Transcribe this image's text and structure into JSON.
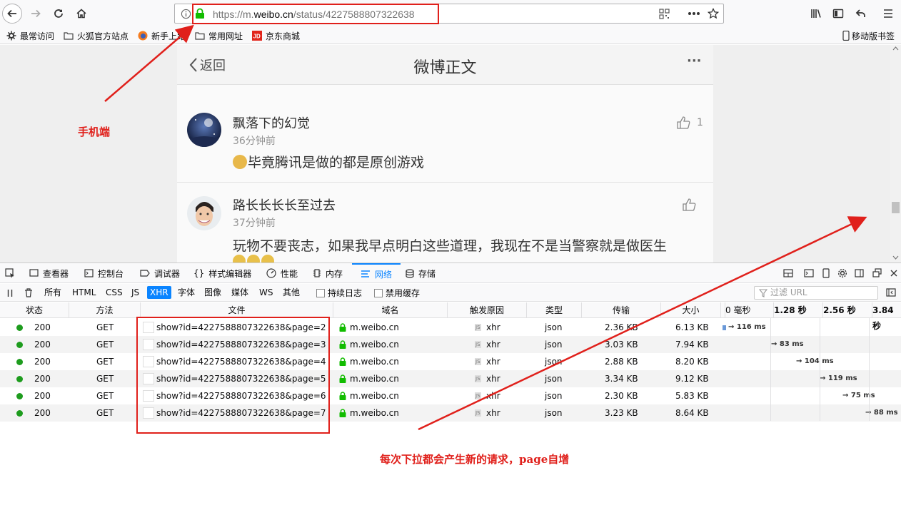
{
  "browser": {
    "url_prefix": "https://m.",
    "url_host": "weibo.cn",
    "url_path": "/status/4227588807322638",
    "bookmarks": [
      "最常访问",
      "火狐官方站点",
      "新手上路",
      "常用网址",
      "京东商城"
    ],
    "mobile_bookmarks": "移动版书签"
  },
  "mobile": {
    "back_label": "返回",
    "title": "微博正文",
    "more": "···",
    "comments": [
      {
        "name": "飘落下的幻觉",
        "time": "36分钟前",
        "text": "毕竟腾讯是做的都是原创游戏",
        "likes": "1"
      },
      {
        "name": "路长长长长至过去",
        "time": "37分钟前",
        "text": "玩物不要丧志，如果我早点明白这些道理，我现在不是当警察就是做医生",
        "likes": ""
      }
    ]
  },
  "devtools": {
    "tabs": [
      "查看器",
      "控制台",
      "调试器",
      "样式编辑器",
      "性能",
      "内存",
      "网络",
      "存储"
    ],
    "active_tab": "网络",
    "filters": [
      "所有",
      "HTML",
      "CSS",
      "JS",
      "XHR",
      "字体",
      "图像",
      "媒体",
      "WS",
      "其他"
    ],
    "active_filter": "XHR",
    "persist_logs": "持续日志",
    "disable_cache": "禁用缓存",
    "filter_url_placeholder": "过滤 URL",
    "columns": [
      "状态",
      "方法",
      "文件",
      "域名",
      "触发原因",
      "类型",
      "传输",
      "大小"
    ],
    "timeline_ticks": [
      "0 毫秒",
      "1.28 秒",
      "2.56 秒",
      "3.84 秒"
    ],
    "requests": [
      {
        "status": "200",
        "method": "GET",
        "file": "show?id=4227588807322638&page=2",
        "domain": "m.weibo.cn",
        "cause": "xhr",
        "type": "json",
        "transferred": "2.36 KB",
        "size": "6.13 KB",
        "timing": "→ 116 ms"
      },
      {
        "status": "200",
        "method": "GET",
        "file": "show?id=4227588807322638&page=3",
        "domain": "m.weibo.cn",
        "cause": "xhr",
        "type": "json",
        "transferred": "3.03 KB",
        "size": "7.94 KB",
        "timing": "→ 83 ms"
      },
      {
        "status": "200",
        "method": "GET",
        "file": "show?id=4227588807322638&page=4",
        "domain": "m.weibo.cn",
        "cause": "xhr",
        "type": "json",
        "transferred": "2.88 KB",
        "size": "8.20 KB",
        "timing": "→ 104 ms"
      },
      {
        "status": "200",
        "method": "GET",
        "file": "show?id=4227588807322638&page=5",
        "domain": "m.weibo.cn",
        "cause": "xhr",
        "type": "json",
        "transferred": "3.34 KB",
        "size": "9.12 KB",
        "timing": "→ 119 ms"
      },
      {
        "status": "200",
        "method": "GET",
        "file": "show?id=4227588807322638&page=6",
        "domain": "m.weibo.cn",
        "cause": "xhr",
        "type": "json",
        "transferred": "2.30 KB",
        "size": "5.83 KB",
        "timing": "→ 75 ms"
      },
      {
        "status": "200",
        "method": "GET",
        "file": "show?id=4227588807322638&page=7",
        "domain": "m.weibo.cn",
        "cause": "xhr",
        "type": "json",
        "transferred": "3.23 KB",
        "size": "8.64 KB",
        "timing": "→ 88 ms"
      }
    ]
  },
  "annotations": {
    "mobile_label": "手机端",
    "note": "每次下拉都会产生新的请求，page自增"
  },
  "colors": {
    "annotation": "#e0201b",
    "accent": "#0a84ff",
    "status_ok": "#1e9c1e"
  },
  "icons": [
    "back-icon",
    "forward-icon",
    "reload-icon",
    "home-icon",
    "info-icon",
    "lock-icon",
    "qr-icon",
    "more-icon",
    "star-icon",
    "library-icon",
    "sidebar-icon",
    "undo-icon",
    "menu-icon",
    "gear-icon",
    "folder-icon",
    "firefox-icon",
    "jd-icon",
    "phone-icon",
    "like-icon",
    "chevron-left-icon",
    "trash-icon",
    "pause-icon"
  ]
}
